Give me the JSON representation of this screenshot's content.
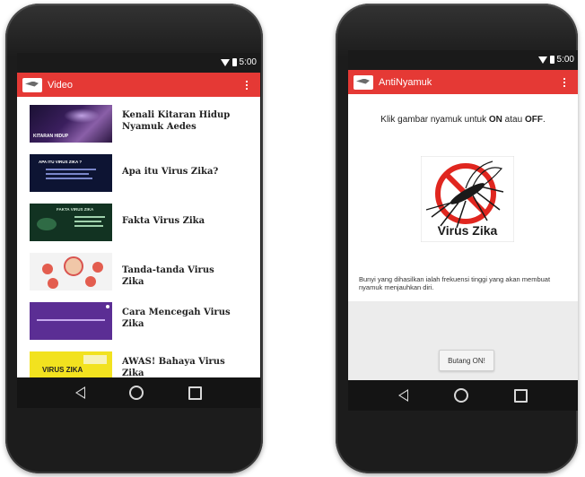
{
  "colors": {
    "appbar_red": "#e53935",
    "statusbar": "#1a1a1a",
    "navbar": "#141414"
  },
  "status": {
    "time": "5:00"
  },
  "phone1": {
    "app_title": "Video",
    "videos": [
      {
        "title": "Kenali Kitaran Hidup Nyamuk Aedes",
        "thumb_caption": "KITARAN HIDUP"
      },
      {
        "title": "Apa itu Virus Zika?",
        "thumb_caption": "APA ITU VIRUS ZIKA ?"
      },
      {
        "title": "Fakta Virus Zika",
        "thumb_caption": "FAKTA VIRUS ZIKA"
      },
      {
        "title": "Tanda-tanda Virus Zika",
        "thumb_caption": ""
      },
      {
        "title": "Cara Mencegah Virus Zika",
        "thumb_caption": ""
      },
      {
        "title": "AWAS! Bahaya Virus Zika",
        "thumb_caption": "VIRUS ZIKA"
      }
    ]
  },
  "phone2": {
    "app_title": "AntiNyamuk",
    "instruction_pre": "Klik gambar nyamuk untuk ",
    "instruction_on": "ON",
    "instruction_mid": " atau ",
    "instruction_off": "OFF",
    "instruction_post": ".",
    "image_label": "Virus Zika",
    "description": "Bunyi yang dihasilkan ialah frekuensi tinggi yang akan membuat nyamuk menjauhkan diri.",
    "button_label": "Butang ON!"
  }
}
